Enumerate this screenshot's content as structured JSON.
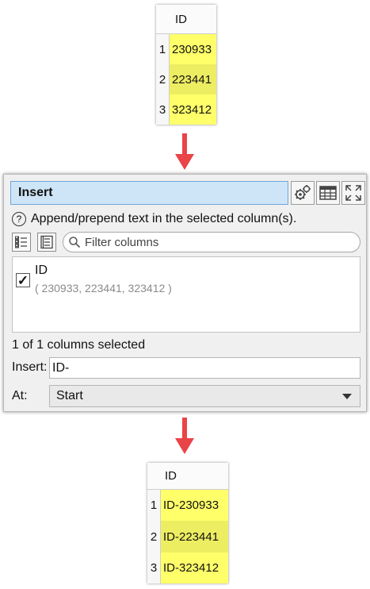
{
  "input_table": {
    "header": "ID",
    "rows": [
      {
        "num": "1",
        "value": "230933"
      },
      {
        "num": "2",
        "value": "223441"
      },
      {
        "num": "3",
        "value": "323412"
      }
    ]
  },
  "dialog": {
    "title": "Insert",
    "toolbar_icons": [
      "gears-icon",
      "table-icon",
      "expand-icon"
    ],
    "description": "Append/prepend text in the selected column(s).",
    "filter_placeholder": "Filter columns",
    "columns": [
      {
        "name": "ID",
        "sample": "( 230933, 223441, 323412 )",
        "checked": true
      }
    ],
    "selection_count": "1 of 1 columns selected",
    "insert_label": "Insert:",
    "insert_value": "ID-",
    "at_label": "At:",
    "at_value": "Start"
  },
  "output_table": {
    "header": "ID",
    "rows": [
      {
        "num": "1",
        "value": "ID-230933"
      },
      {
        "num": "2",
        "value": "ID-223441"
      },
      {
        "num": "3",
        "value": "ID-323412"
      }
    ]
  },
  "colors": {
    "cell_light": "#ffff6a",
    "cell_dark": "#eded62",
    "arrow": "#e94448",
    "title_bg": "#cde5f7"
  }
}
